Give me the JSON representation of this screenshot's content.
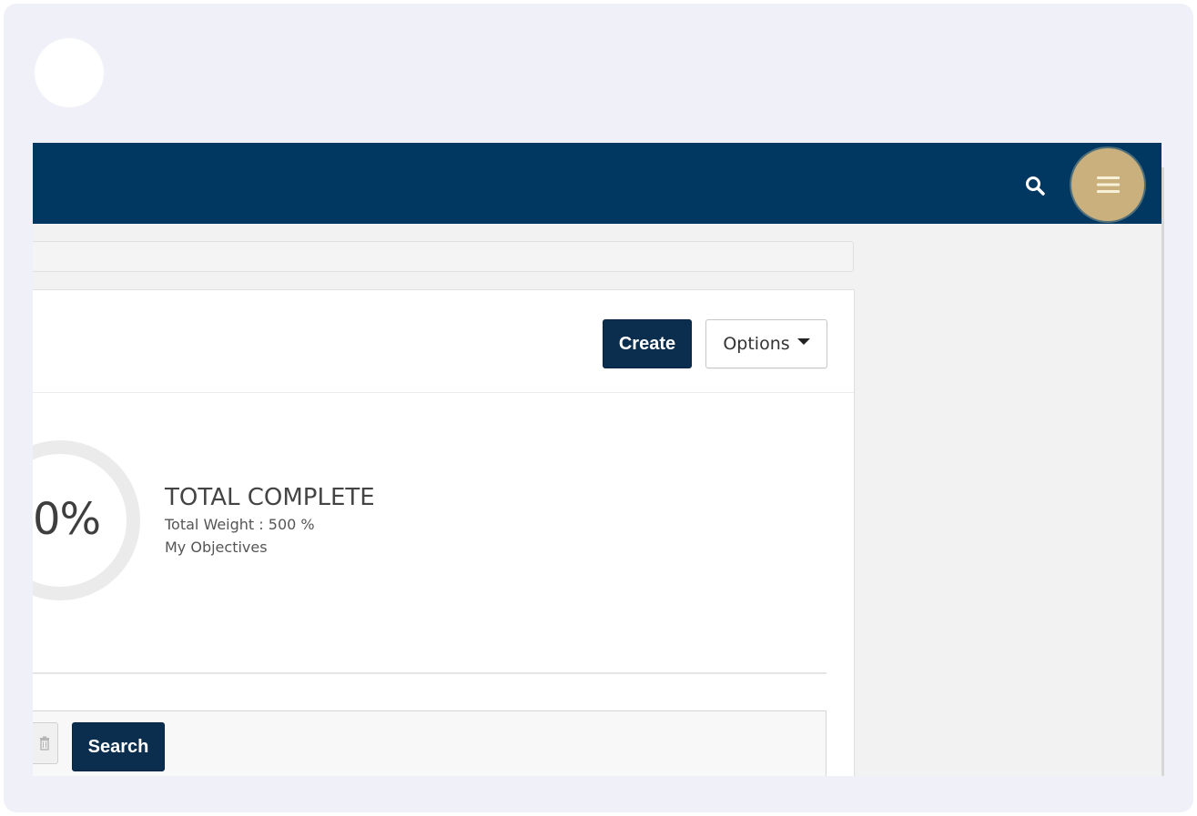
{
  "header": {
    "search_icon": "search-icon",
    "menu_icon": "hamburger-icon"
  },
  "toolbar": {
    "create_label": "Create",
    "options_label": "Options"
  },
  "summary": {
    "percent_complete": "0%",
    "title": "TOTAL COMPLETE",
    "total_weight": "Total Weight : 500 %",
    "scope": "My Objectives"
  },
  "filters": {
    "clear_icon": "trash-icon",
    "search_label": "Search"
  },
  "colors": {
    "header_bg": "#003862",
    "primary_button": "#0b2e4f",
    "menu_highlight": "#c9b07c"
  }
}
